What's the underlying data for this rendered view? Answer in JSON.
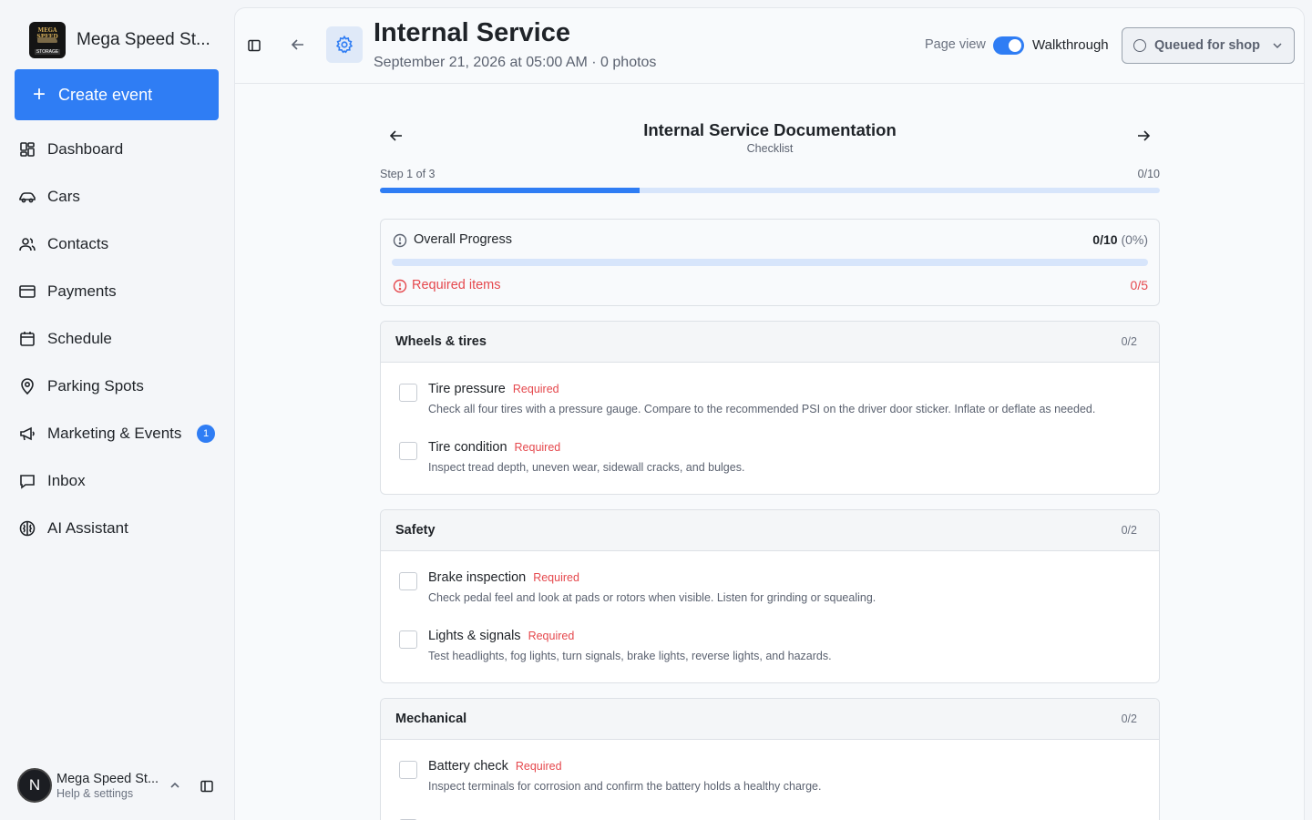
{
  "sidebar": {
    "brand_name": "Mega Speed St...",
    "logo": {
      "top_text": "MEGA SPEED",
      "bottom_text": "STORAGE"
    },
    "create_label": "Create event",
    "nav": [
      {
        "label": "Dashboard",
        "icon": "dashboard-icon"
      },
      {
        "label": "Cars",
        "icon": "car-icon"
      },
      {
        "label": "Contacts",
        "icon": "contacts-icon"
      },
      {
        "label": "Payments",
        "icon": "credit-card-icon"
      },
      {
        "label": "Schedule",
        "icon": "calendar-icon"
      },
      {
        "label": "Parking Spots",
        "icon": "map-pin-icon"
      },
      {
        "label": "Marketing & Events",
        "icon": "megaphone-icon",
        "badge": "1"
      },
      {
        "label": "Inbox",
        "icon": "inbox-icon"
      },
      {
        "label": "AI Assistant",
        "icon": "brain-icon"
      }
    ],
    "user": {
      "initial": "N",
      "name": "Mega Speed St...",
      "subtitle": "Help & settings"
    }
  },
  "header": {
    "title": "Internal Service",
    "subtitle": "September 21, 2026 at 05:00 AM · 0 photos",
    "page_view_label": "Page view",
    "walkthrough_label": "Walkthrough",
    "walkthrough_on": true,
    "status_label": "Queued for shop"
  },
  "document": {
    "title": "Internal Service Documentation",
    "subtitle": "Checklist",
    "step_label": "Step 1 of 3",
    "step_count": "0/10",
    "step_progress": 0.333
  },
  "overall": {
    "label": "Overall Progress",
    "value": "0/10",
    "percent": "(0%)",
    "progress": 0,
    "required_label": "Required items",
    "required_value": "0/5"
  },
  "sections": [
    {
      "title": "Wheels & tires",
      "count": "0/2",
      "items": [
        {
          "name": "Tire pressure",
          "tag": "Required",
          "desc": "Check all four tires with a pressure gauge. Compare to the recommended PSI on the driver door sticker. Inflate or deflate as needed."
        },
        {
          "name": "Tire condition",
          "tag": "Required",
          "desc": "Inspect tread depth, uneven wear, sidewall cracks, and bulges."
        }
      ]
    },
    {
      "title": "Safety",
      "count": "0/2",
      "items": [
        {
          "name": "Brake inspection",
          "tag": "Required",
          "desc": "Check pedal feel and look at pads or rotors when visible. Listen for grinding or squealing."
        },
        {
          "name": "Lights & signals",
          "tag": "Required",
          "desc": "Test headlights, fog lights, turn signals, brake lights, reverse lights, and hazards."
        }
      ]
    },
    {
      "title": "Mechanical",
      "count": "0/2",
      "items": [
        {
          "name": "Battery check",
          "tag": "Required",
          "desc": "Inspect terminals for corrosion and confirm the battery holds a healthy charge."
        }
      ]
    }
  ],
  "colors": {
    "accent": "#2f7df4",
    "required": "#e5484d",
    "track": "#d7e5fb"
  }
}
